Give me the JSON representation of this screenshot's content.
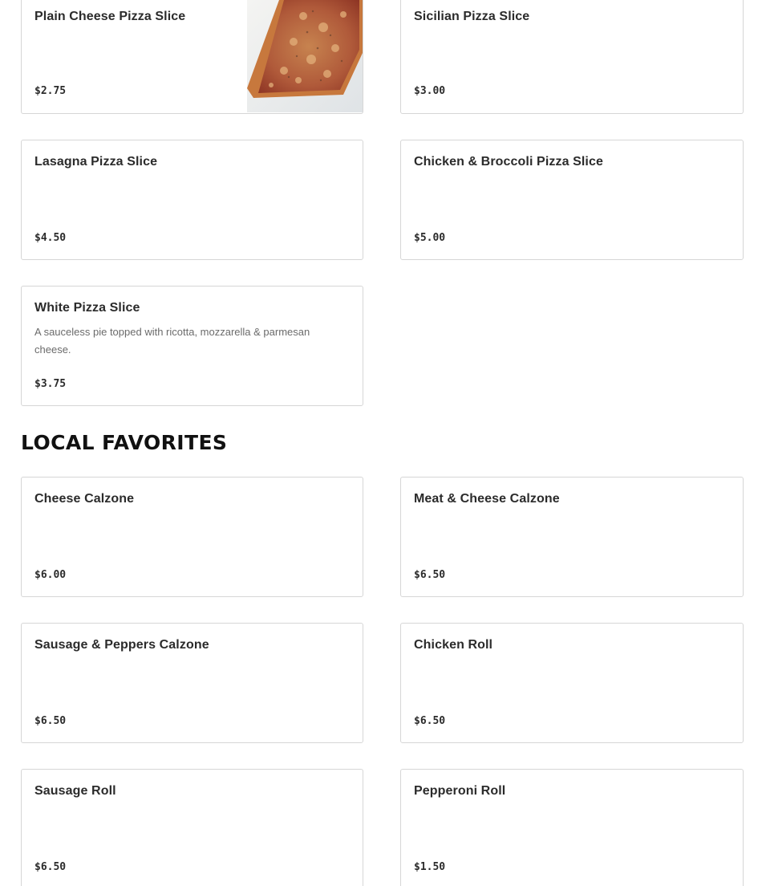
{
  "sections": {
    "slices": {
      "items": [
        {
          "name": "Plain Cheese Pizza Slice",
          "price": "$2.75",
          "description": ""
        },
        {
          "name": "Sicilian Pizza Slice",
          "price": "$3.00",
          "description": ""
        },
        {
          "name": "Lasagna Pizza Slice",
          "price": "$4.50",
          "description": ""
        },
        {
          "name": "Chicken & Broccoli Pizza Slice",
          "price": "$5.00",
          "description": ""
        },
        {
          "name": "White Pizza Slice",
          "price": "$3.75",
          "description": "A sauceless pie topped with ricotta, mozzarella & parmesan cheese."
        }
      ]
    },
    "local_favorites": {
      "heading": "LOCAL FAVORITES",
      "items": [
        {
          "name": "Cheese Calzone",
          "price": "$6.00"
        },
        {
          "name": "Meat & Cheese Calzone",
          "price": "$6.50"
        },
        {
          "name": "Sausage & Peppers Calzone",
          "price": "$6.50"
        },
        {
          "name": "Chicken Roll",
          "price": "$6.50"
        },
        {
          "name": "Sausage Roll",
          "price": "$6.50"
        },
        {
          "name": "Pepperoni Roll",
          "price": "$1.50"
        }
      ]
    }
  },
  "colors": {
    "text": "#2b2b2b",
    "muted": "#6b6b6b",
    "border": "#d6d6d6",
    "heading": "#111111"
  }
}
